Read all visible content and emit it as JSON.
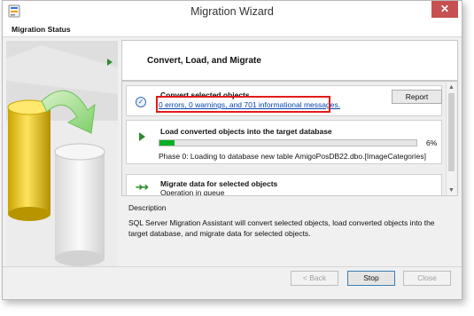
{
  "window": {
    "title": "Migration Wizard",
    "close_glyph": "✕"
  },
  "header": {
    "title": "Migration Status"
  },
  "convert": {
    "title": "Convert, Load, and Migrate"
  },
  "steps": [
    {
      "title": "Convert selected objects",
      "link": "0 errors, 0 warnings, and 701 informational messages.",
      "report_label": "Report",
      "icon": "check-circle-icon"
    },
    {
      "title": "Load converted objects into the target database",
      "progress_percent": 6,
      "progress_label": "6%",
      "phase": "Phase 0: Loading to database new table AmigoPosDB22.dbo.[ImageCategories]",
      "icon": "play-icon"
    },
    {
      "title": "Migrate data for selected objects",
      "status": "Operation in queue",
      "icon": "fast-forward-icon"
    }
  ],
  "description": {
    "label": "Description",
    "text": "SQL Server Migration Assistant will convert selected objects, load converted objects into the target database, and migrate data for selected objects."
  },
  "buttons": {
    "back": "< Back",
    "stop": "Stop",
    "close": "Close"
  },
  "colors": {
    "highlight": "#e21b1b",
    "progress": "#06b025",
    "link": "#0645ad",
    "accent_green": "#2e8b2e"
  }
}
